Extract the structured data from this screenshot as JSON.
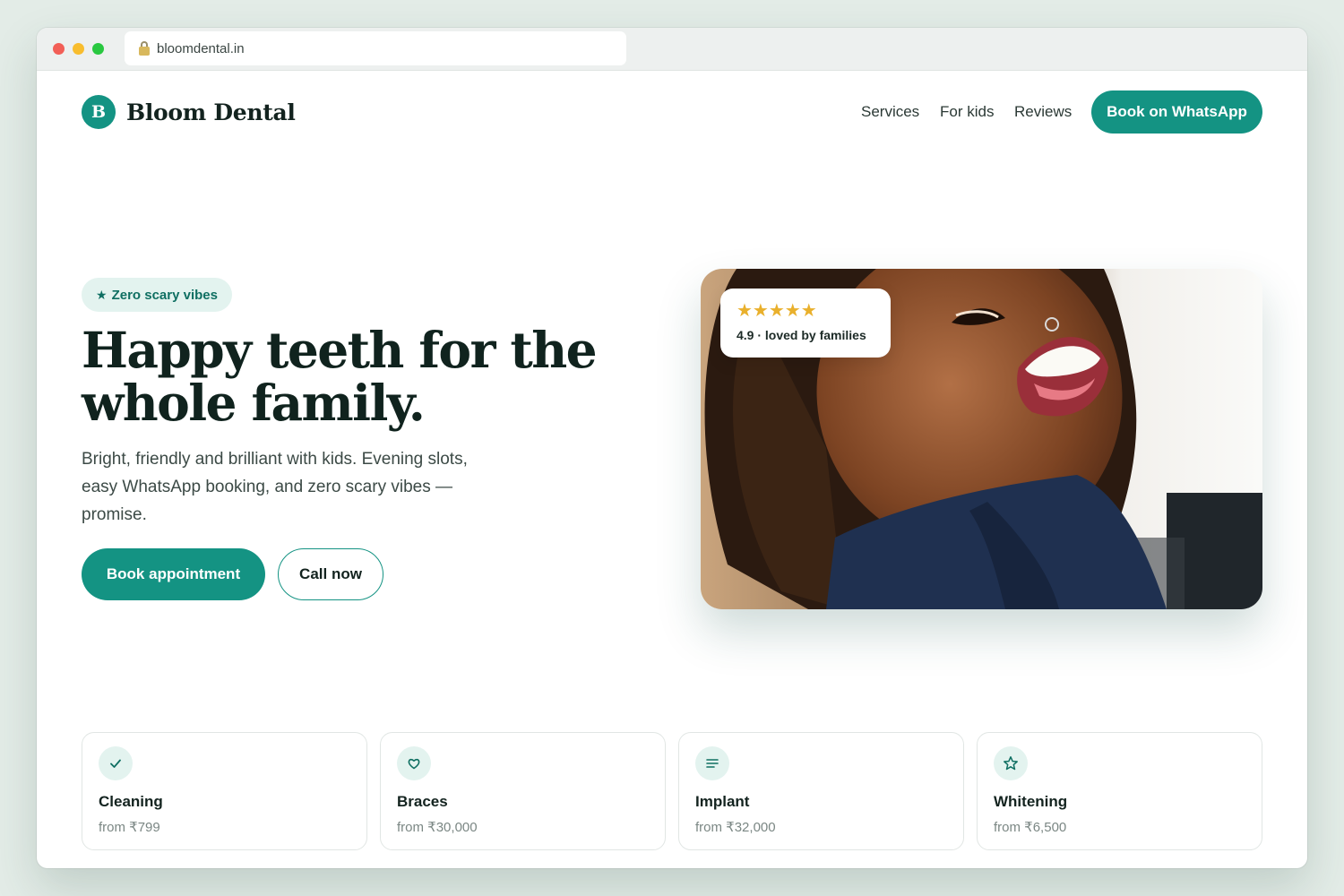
{
  "browser": {
    "url": "bloomdental.in"
  },
  "brand": {
    "initial": "B",
    "name": "Bloom Dental",
    "accent_color": "#149383"
  },
  "nav": {
    "links": [
      "Services",
      "For kids",
      "Reviews"
    ],
    "cta": "Book on WhatsApp"
  },
  "hero": {
    "badge": "Zero scary vibes",
    "headline": "Happy teeth for the whole family.",
    "subcopy": "Bright, friendly and brilliant with kids. Evening slots, easy WhatsApp booking, and zero scary vibes — promise.",
    "primary_cta": "Book appointment",
    "secondary_cta": "Call now"
  },
  "rating": {
    "stars": "★★★★★",
    "star_count": 5,
    "text": "4.9 · loved by families"
  },
  "services": [
    {
      "name": "Cleaning",
      "price": "from ₹799",
      "icon": "check-icon"
    },
    {
      "name": "Braces",
      "price": "from ₹30,000",
      "icon": "heart-icon"
    },
    {
      "name": "Implant",
      "price": "from ₹32,000",
      "icon": "lines-icon"
    },
    {
      "name": "Whitening",
      "price": "from ₹6,500",
      "icon": "star-icon"
    }
  ]
}
